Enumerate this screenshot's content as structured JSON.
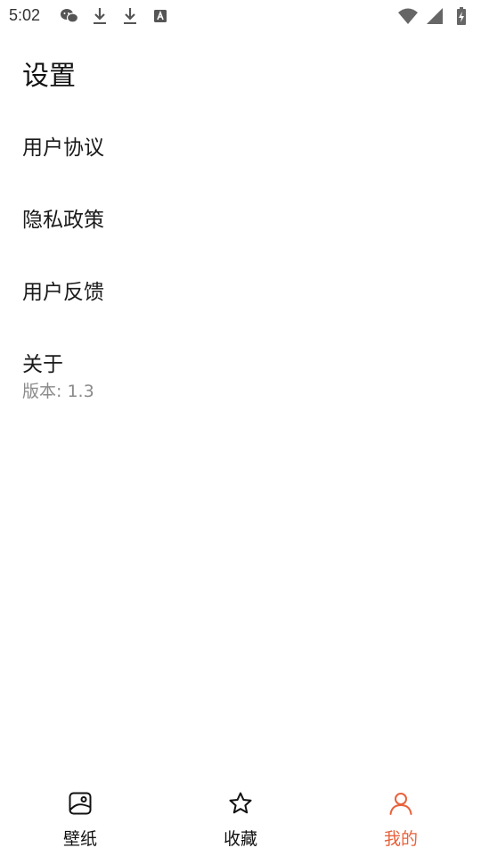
{
  "status_bar": {
    "time": "5:02",
    "left_icons": [
      "wechat-icon",
      "download-icon",
      "download-icon",
      "font-app-icon"
    ],
    "right_icons": [
      "wifi-icon",
      "signal-icon",
      "battery-charging-icon"
    ]
  },
  "page": {
    "title": "设置"
  },
  "settings": {
    "items": [
      {
        "label": "用户协议"
      },
      {
        "label": "隐私政策"
      },
      {
        "label": "用户反馈"
      }
    ],
    "about": {
      "label": "关于",
      "version": "版本: 1.3"
    }
  },
  "bottom_nav": {
    "active_color": "#e8623c",
    "items": [
      {
        "label": "壁纸",
        "icon": "wallpaper-icon"
      },
      {
        "label": "收藏",
        "icon": "star-icon"
      },
      {
        "label": "我的",
        "icon": "user-icon",
        "active": true
      }
    ]
  }
}
